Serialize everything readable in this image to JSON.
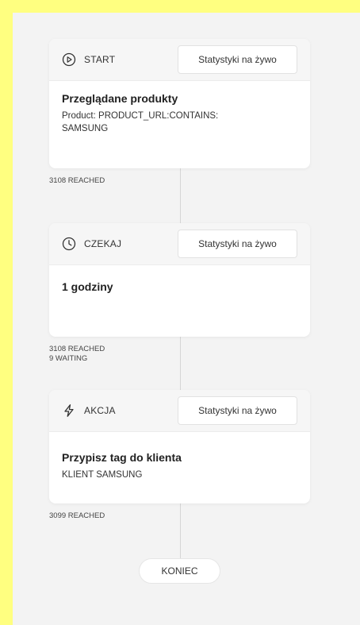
{
  "steps": [
    {
      "icon": "play-circle-icon",
      "label": "START",
      "stats_button": "Statystyki na żywo",
      "title": "Przeglądane produkty",
      "detail": "Product: PRODUCT_URL:CONTAINS: SAMSUNG",
      "stats": [
        "3108 REACHED"
      ]
    },
    {
      "icon": "clock-icon",
      "label": "CZEKAJ",
      "stats_button": "Statystyki na żywo",
      "title": "1 godziny",
      "detail": "",
      "stats": [
        "3108 REACHED",
        "9 WAITING"
      ]
    },
    {
      "icon": "lightning-icon",
      "label": "AKCJA",
      "stats_button": "Statystyki na żywo",
      "title": "Przypisz tag do klienta",
      "detail": "KLIENT SAMSUNG",
      "stats": [
        "3099 REACHED"
      ]
    }
  ],
  "end": {
    "label": "KONIEC"
  },
  "colors": {
    "page_border": "#ffff80",
    "canvas": "#f3f3f3",
    "card_header": "#f6f6f6"
  }
}
